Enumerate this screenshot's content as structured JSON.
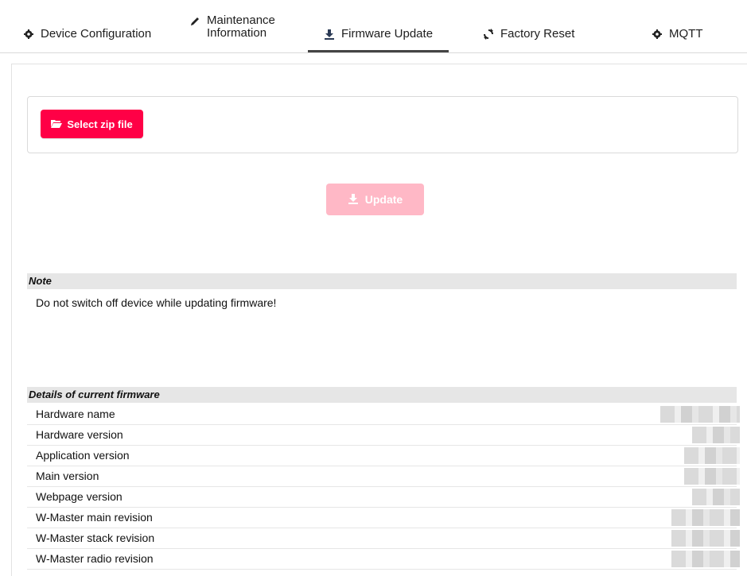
{
  "tabs": [
    {
      "label": "Device Configuration",
      "icon": "gear-icon"
    },
    {
      "label_line1": "Maintenance",
      "label_line2": "Information",
      "icon": "pencil-icon"
    },
    {
      "label": "Firmware Update",
      "icon": "download-icon",
      "active": true
    },
    {
      "label": "Factory Reset",
      "icon": "refresh-icon"
    },
    {
      "label": "MQTT",
      "icon": "gear-icon"
    }
  ],
  "upload": {
    "select_label": "Select zip file",
    "update_label": "Update"
  },
  "note": {
    "heading": "Note",
    "text": "Do not switch off device while updating firmware!"
  },
  "details": {
    "heading": "Details of current firmware",
    "rows": [
      {
        "label": "Hardware name"
      },
      {
        "label": "Hardware version"
      },
      {
        "label": "Application version"
      },
      {
        "label": "Main version"
      },
      {
        "label": "Webpage version"
      },
      {
        "label": "W-Master main revision"
      },
      {
        "label": "W-Master stack revision"
      },
      {
        "label": "W-Master radio revision"
      }
    ]
  },
  "colors": {
    "accent": "#ff0046",
    "accent_disabled": "#ffb8c6",
    "section_bg": "#e6e6e6"
  }
}
